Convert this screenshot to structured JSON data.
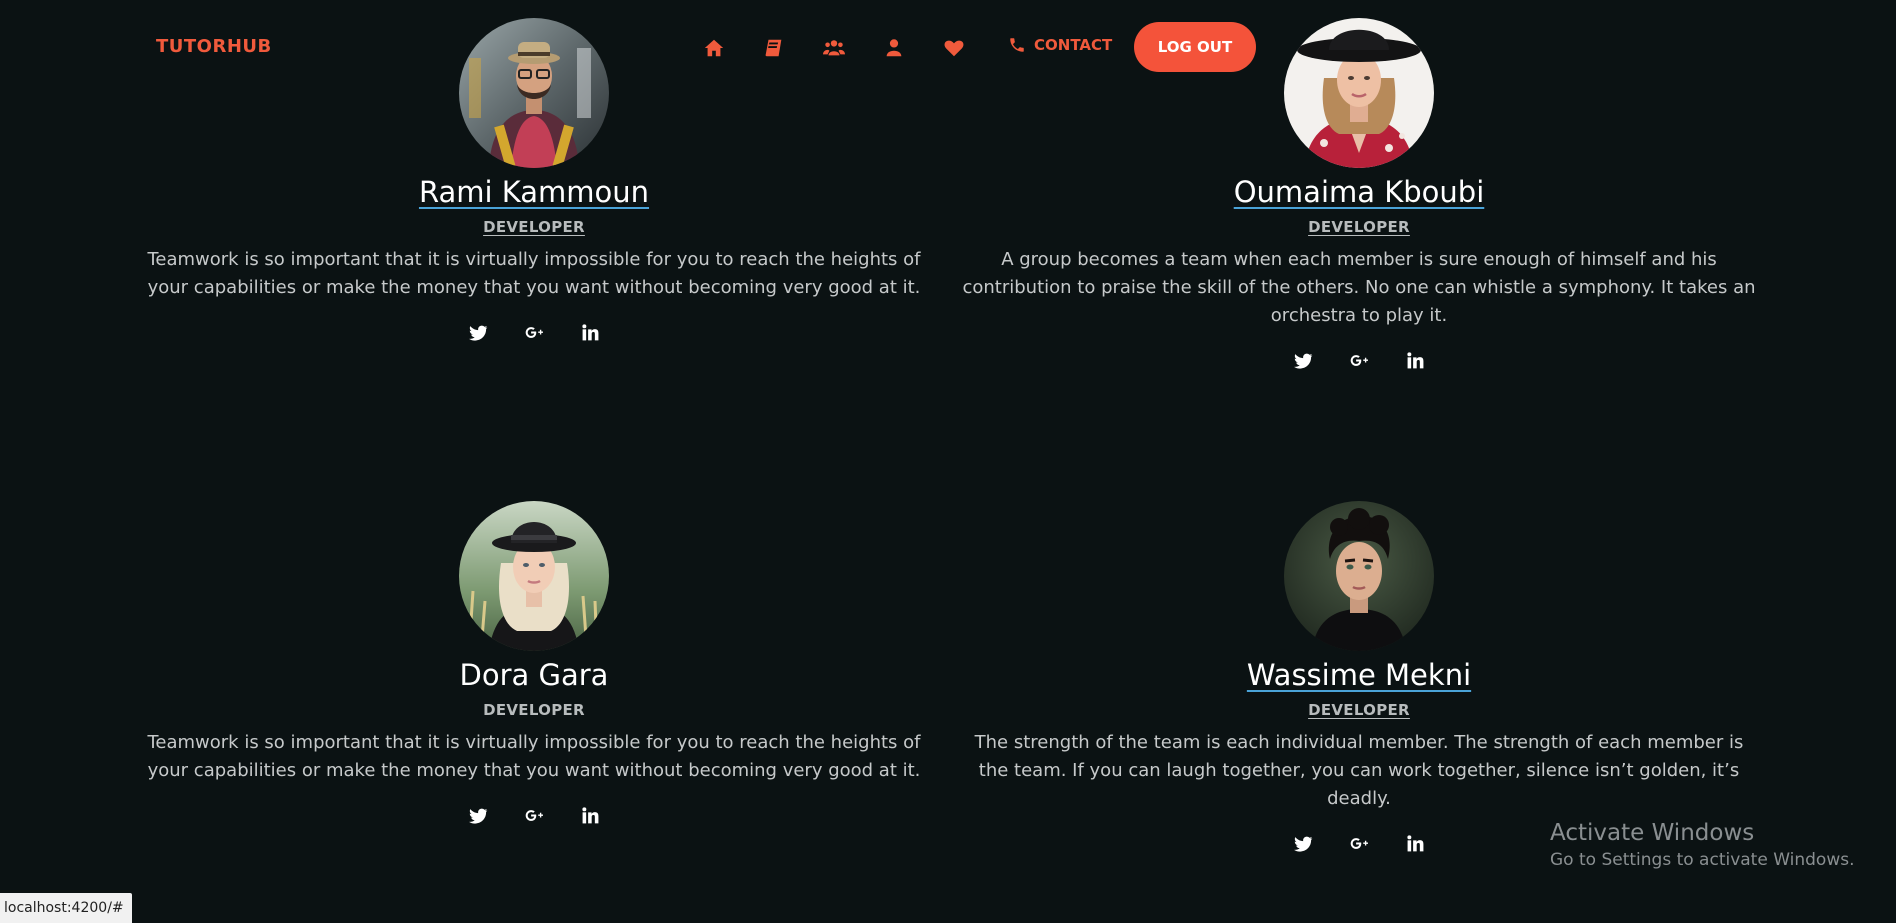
{
  "header": {
    "brand": "TUTORHUB",
    "nav_icons": [
      "home-icon",
      "book-icon",
      "users-icon",
      "user-icon",
      "heart-icon"
    ],
    "contact_label": "CONTACT",
    "contact_icon": "phone-icon",
    "logout_label": "LOG OUT",
    "accent_color": "#f05a3c"
  },
  "members": [
    {
      "name": "Rami Kammoun",
      "role": "DEVELOPER",
      "quote": "Teamwork is so important that it is virtually impossible for you to reach the heights of your capabilities or make the money that you want without becoming very good at it.",
      "socials": [
        "twitter-icon",
        "google-plus-icon",
        "linkedin-icon"
      ]
    },
    {
      "name": "Oumaima Kboubi",
      "role": "DEVELOPER",
      "quote": "A group becomes a team when each member is sure enough of himself and his contribution to praise the skill of the others. No one can whistle a symphony. It takes an orchestra to play it.",
      "socials": [
        "twitter-icon",
        "google-plus-icon",
        "linkedin-icon"
      ]
    },
    {
      "name": "Dora Gara",
      "role": "DEVELOPER",
      "quote": "Teamwork is so important that it is virtually impossible for you to reach the heights of your capabilities or make the money that you want without becoming very good at it.",
      "socials": [
        "twitter-icon",
        "google-plus-icon",
        "linkedin-icon"
      ]
    },
    {
      "name": "Wassime Mekni",
      "role": "DEVELOPER",
      "quote": "The strength of the team is each individual member. The strength of each member is the team. If you can laugh together, you can work together, silence isn’t golden, it’s deadly.",
      "socials": [
        "twitter-icon",
        "google-plus-icon",
        "linkedin-icon"
      ]
    }
  ],
  "watermark": {
    "title": "Activate Windows",
    "subtitle": "Go to Settings to activate Windows."
  },
  "status_bar": {
    "url": "localhost:4200/#"
  }
}
